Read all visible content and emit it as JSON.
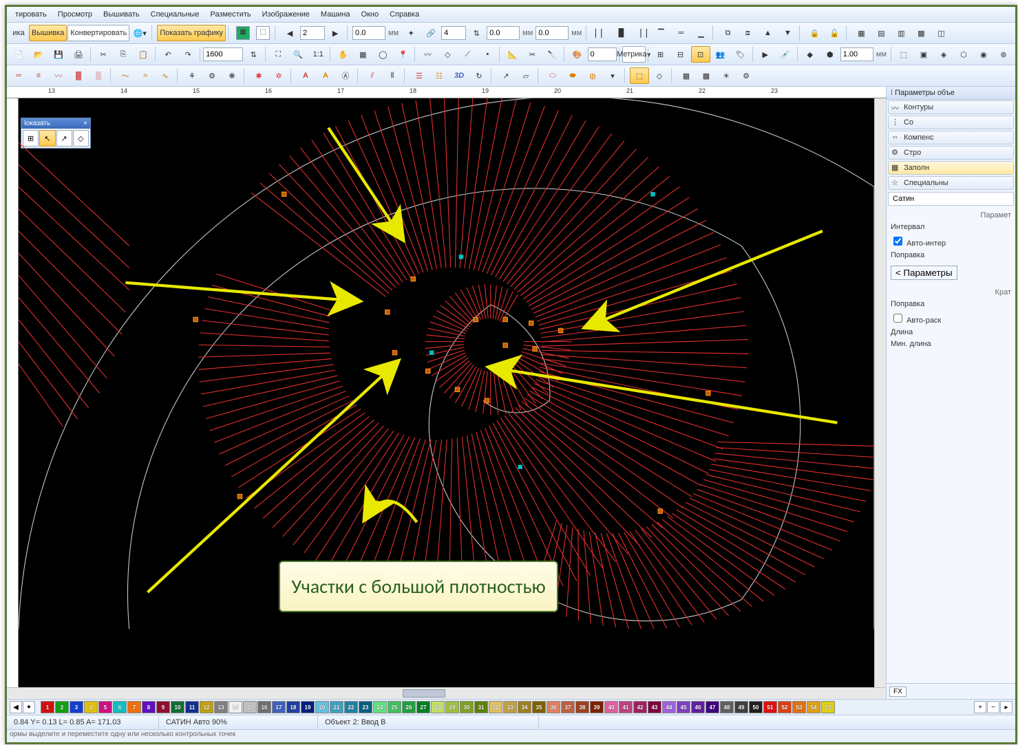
{
  "menu": {
    "items": [
      "тировать",
      "Просмотр",
      "Вышивать",
      "Специальные",
      "Разместить",
      "Изображение",
      "Машина",
      "Окно",
      "Справка"
    ]
  },
  "toolbar1": {
    "btn_graphics": "ика",
    "btn_embroidery": "Вышивка",
    "btn_convert": "Конвертировать",
    "btn_show_graphics": "Показать графику",
    "zoom_value": "1600",
    "val_a": "2",
    "val_b": "0.0",
    "unit_mm": "мм",
    "val_c": "4",
    "val_d": "0.0",
    "val_e": "0.0"
  },
  "toolbar2": {
    "val_f": "0",
    "metric_label": "Метрика",
    "scale_value": "1.00",
    "unit_mm": "мм"
  },
  "toolbar3": {
    "label_3d": "3D"
  },
  "ruler_marks": [
    "13",
    "14",
    "15",
    "16",
    "17",
    "18",
    "19",
    "20",
    "21",
    "22",
    "23"
  ],
  "floater": {
    "title": "Іоказать",
    "close": "×"
  },
  "callout_text": "Участки с большой плотностью",
  "rightpanel": {
    "title": "Параметры объе",
    "tabs": [
      "Контуры",
      "Со",
      "Компенс",
      "Стро",
      "Заполн",
      "Специальны"
    ],
    "section": "Сатин",
    "params_hdr": "Парамет",
    "interval": "Интервал",
    "auto_interval": "Авто-интер",
    "correction": "Поправка",
    "params_btn": "Параметры",
    "short": "Крат",
    "correction2": "Поправка",
    "auto_split": "Авто-раск",
    "length": "Длина",
    "min_length": "Мин. длина",
    "fx": "FX"
  },
  "palette_colors": [
    "#d01010",
    "#10a010",
    "#1040d0",
    "#e0c010",
    "#d01080",
    "#10c0c0",
    "#f07010",
    "#6010c0",
    "#901030",
    "#107030",
    "#103090",
    "#c0a010",
    "#808080",
    "#f0f0f0",
    "#c0c0c0",
    "#707070",
    "#4060c0",
    "#2040a0",
    "#002080",
    "#60c0e0",
    "#40a0c0",
    "#2080a0",
    "#006080",
    "#60e080",
    "#40c060",
    "#20a040",
    "#008020",
    "#c0e060",
    "#a0c040",
    "#80a020",
    "#608000",
    "#e0c060",
    "#c0a040",
    "#a08020",
    "#806000",
    "#e08060",
    "#c06040",
    "#a04020",
    "#802000",
    "#e060a0",
    "#c04080",
    "#a02060",
    "#800040",
    "#a060e0",
    "#8040c0",
    "#6020a0",
    "#400080",
    "#606060",
    "#404040",
    "#202020",
    "#e01010",
    "#e04010",
    "#e07010",
    "#e0a010",
    "#e0d010"
  ],
  "status": {
    "coords": "0.84 Y=   0.13 L=   0.85 A= 171.03",
    "stitch_type": "САТИН Авто 90%",
    "object": "Объект 2: Ввод В"
  },
  "status2": "ормы выделите и переместите одну или несколько контрольных точек"
}
